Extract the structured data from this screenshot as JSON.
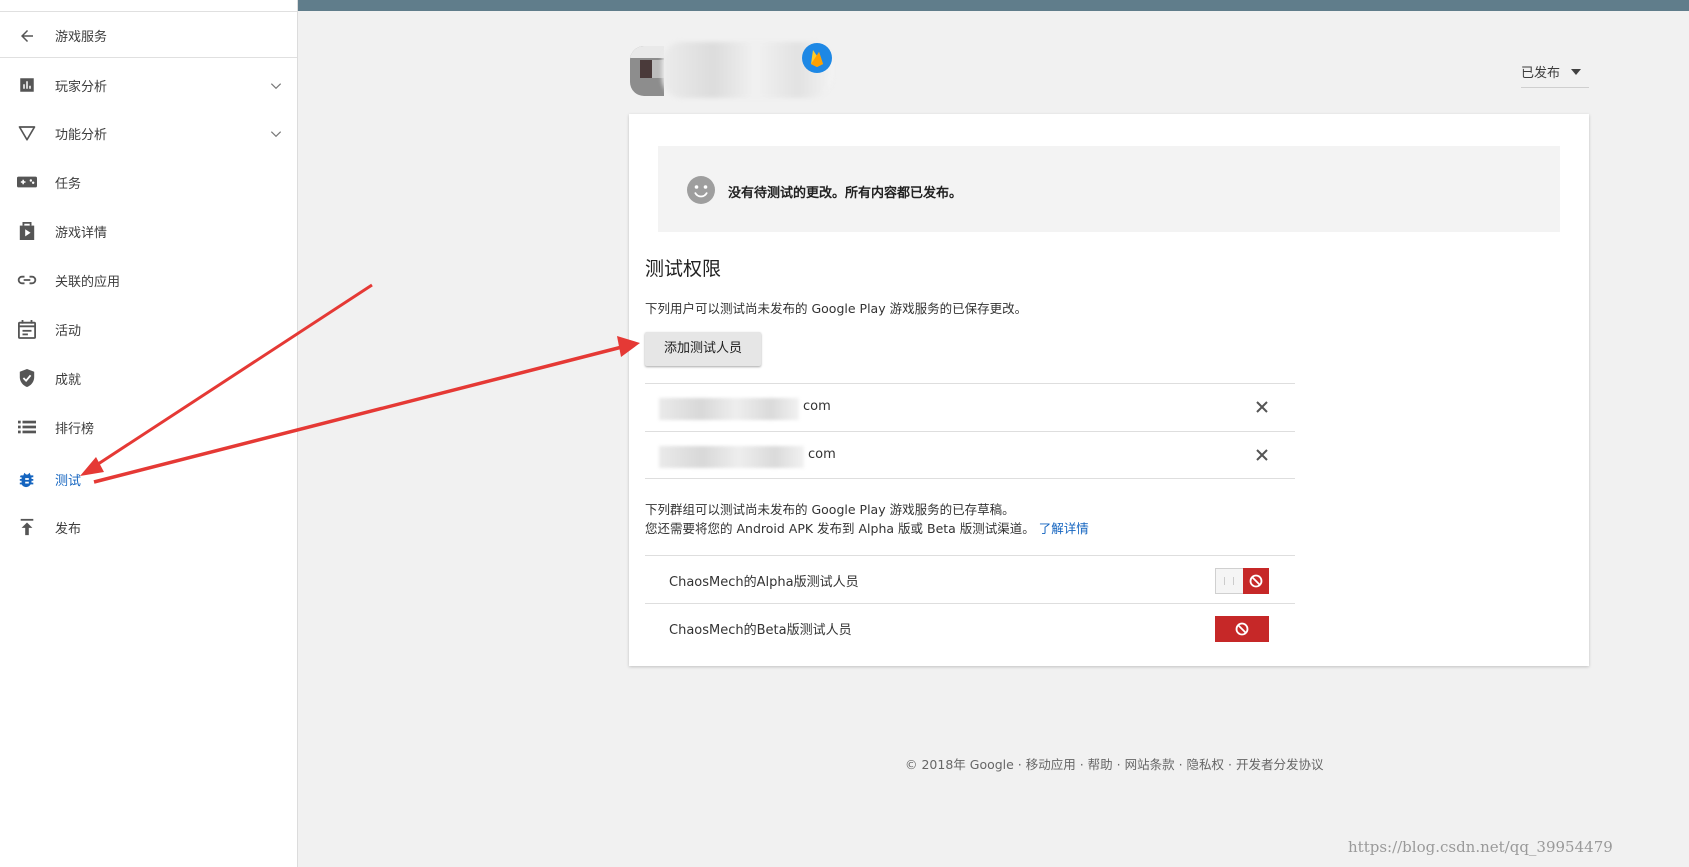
{
  "sidebar": {
    "back_label": "游戏服务",
    "items": [
      {
        "label": "玩家分析",
        "icon": "bar-chart-icon",
        "expandable": true
      },
      {
        "label": "功能分析",
        "icon": "funnel-icon",
        "expandable": true
      },
      {
        "label": "任务",
        "icon": "gamepad-icon"
      },
      {
        "label": "游戏详情",
        "icon": "play-box-icon"
      },
      {
        "label": "关联的应用",
        "icon": "link-icon"
      },
      {
        "label": "活动",
        "icon": "calendar-icon"
      },
      {
        "label": "成就",
        "icon": "shield-check-icon"
      },
      {
        "label": "排行榜",
        "icon": "list-icon"
      },
      {
        "label": "测试",
        "icon": "bug-icon",
        "active": true
      },
      {
        "label": "发布",
        "icon": "publish-icon"
      }
    ]
  },
  "header": {
    "status_label": "已发布"
  },
  "notice": {
    "message": "没有待测试的更改。所有内容都已发布。"
  },
  "testing": {
    "title": "测试权限",
    "users_desc": "下列用户可以测试尚未发布的 Google Play 游戏服务的已保存更改。",
    "add_tester_label": "添加测试人员",
    "testers": [
      {
        "email_suffix": "com"
      },
      {
        "email_suffix": "com"
      }
    ],
    "groups_desc_line1": "下列群组可以测试尚未发布的 Google Play 游戏服务的已存草稿。",
    "groups_desc_line2": "您还需要将您的 Android APK 发布到 Alpha 版或 Beta 版测试渠道。",
    "learn_more": "了解详情",
    "groups": [
      {
        "name": "ChaosMech的Alpha版测试人员"
      },
      {
        "name": "ChaosMech的Beta版测试人员"
      }
    ]
  },
  "footer": {
    "text": "© 2018年 Google · 移动应用 · 帮助 · 网站条款 · 隐私权 · 开发者分发协议"
  },
  "watermark": "https://blog.csdn.net/qq_39954479",
  "colors": {
    "topbar": "#607d8b",
    "accent": "#1565c0",
    "danger": "#c62828",
    "annotation_arrow": "#e53935"
  }
}
